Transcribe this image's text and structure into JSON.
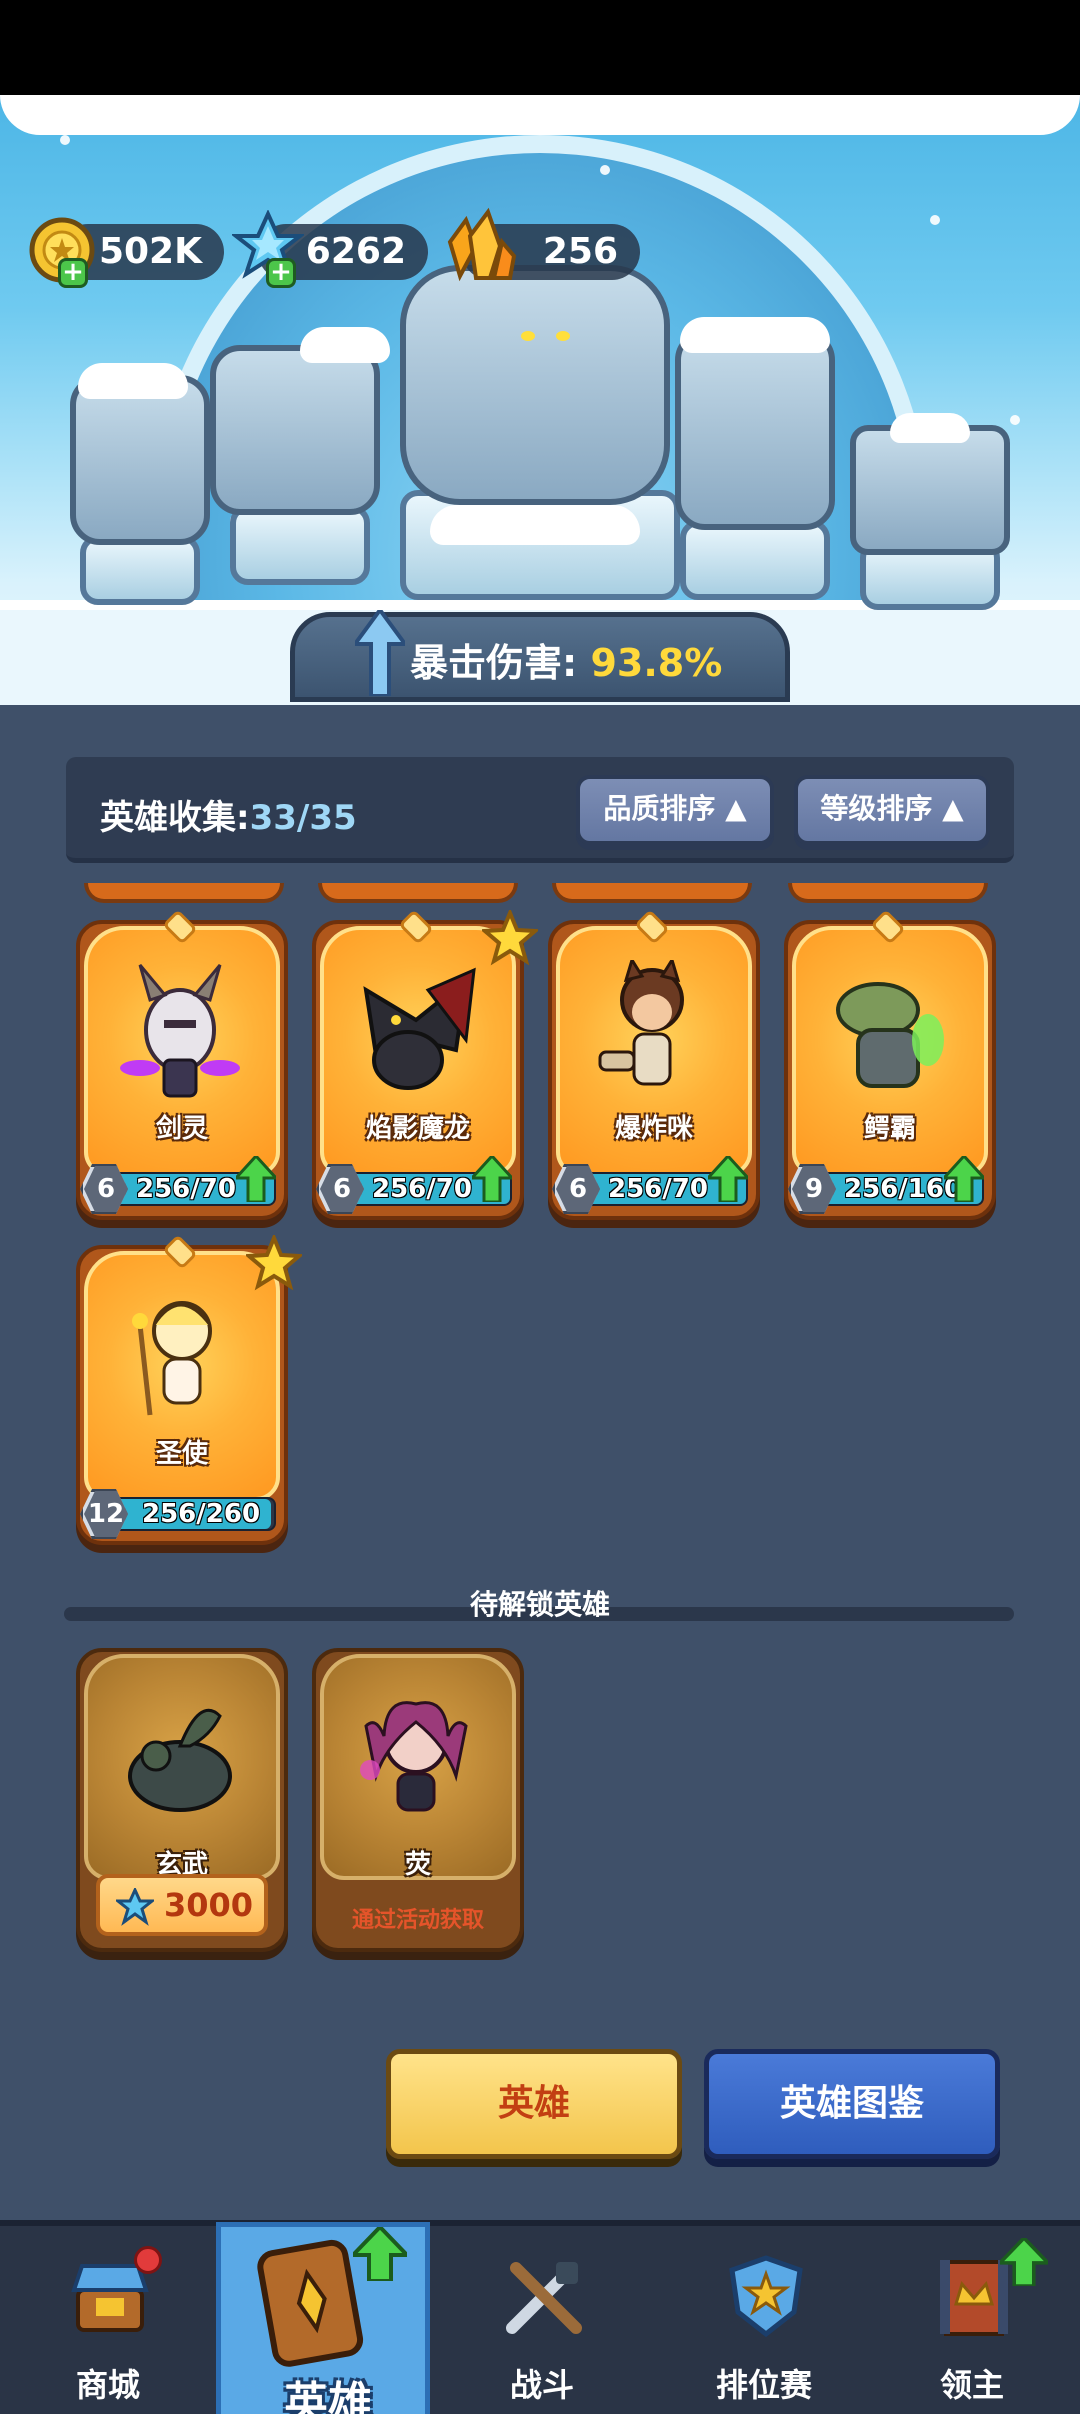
{
  "resources": {
    "gold": "502K",
    "crystal": "6262",
    "amber": "256"
  },
  "banner": {
    "crit_label": "暴击伤害:",
    "crit_value": "93.8%"
  },
  "collection": {
    "label": "英雄收集:",
    "count": "33/35",
    "sort_quality": "品质排序",
    "sort_level": "等级排序"
  },
  "heroes": [
    {
      "name": "剑灵",
      "level": "6",
      "progress": "256/70",
      "fill": 1.0,
      "upgradable": true,
      "starred": false
    },
    {
      "name": "焰影魔龙",
      "level": "6",
      "progress": "256/70",
      "fill": 1.0,
      "upgradable": true,
      "starred": true
    },
    {
      "name": "爆炸咪",
      "level": "6",
      "progress": "256/70",
      "fill": 1.0,
      "upgradable": true,
      "starred": false
    },
    {
      "name": "鳄霸",
      "level": "9",
      "progress": "256/160",
      "fill": 1.0,
      "upgradable": true,
      "starred": false
    },
    {
      "name": "圣使",
      "level": "12",
      "progress": "256/260",
      "fill": 0.98,
      "upgradable": false,
      "starred": true
    }
  ],
  "locked_section": {
    "title": "待解锁英雄",
    "heroes": [
      {
        "name": "玄武",
        "price": "3000"
      },
      {
        "name": "荧",
        "unlock_hint": "通过活动获取"
      }
    ]
  },
  "actions": {
    "heroes": "英雄",
    "codex": "英雄图鉴"
  },
  "nav": {
    "shop": "商城",
    "heroes": "英雄",
    "battle": "战斗",
    "ranked": "排位赛",
    "lord": "领主"
  },
  "colors": {
    "accent_yellow": "#ffd93b",
    "collect_count": "#9fd7f6",
    "panel_bg": "#3f5069",
    "nav_active": "#5aa9e6"
  }
}
